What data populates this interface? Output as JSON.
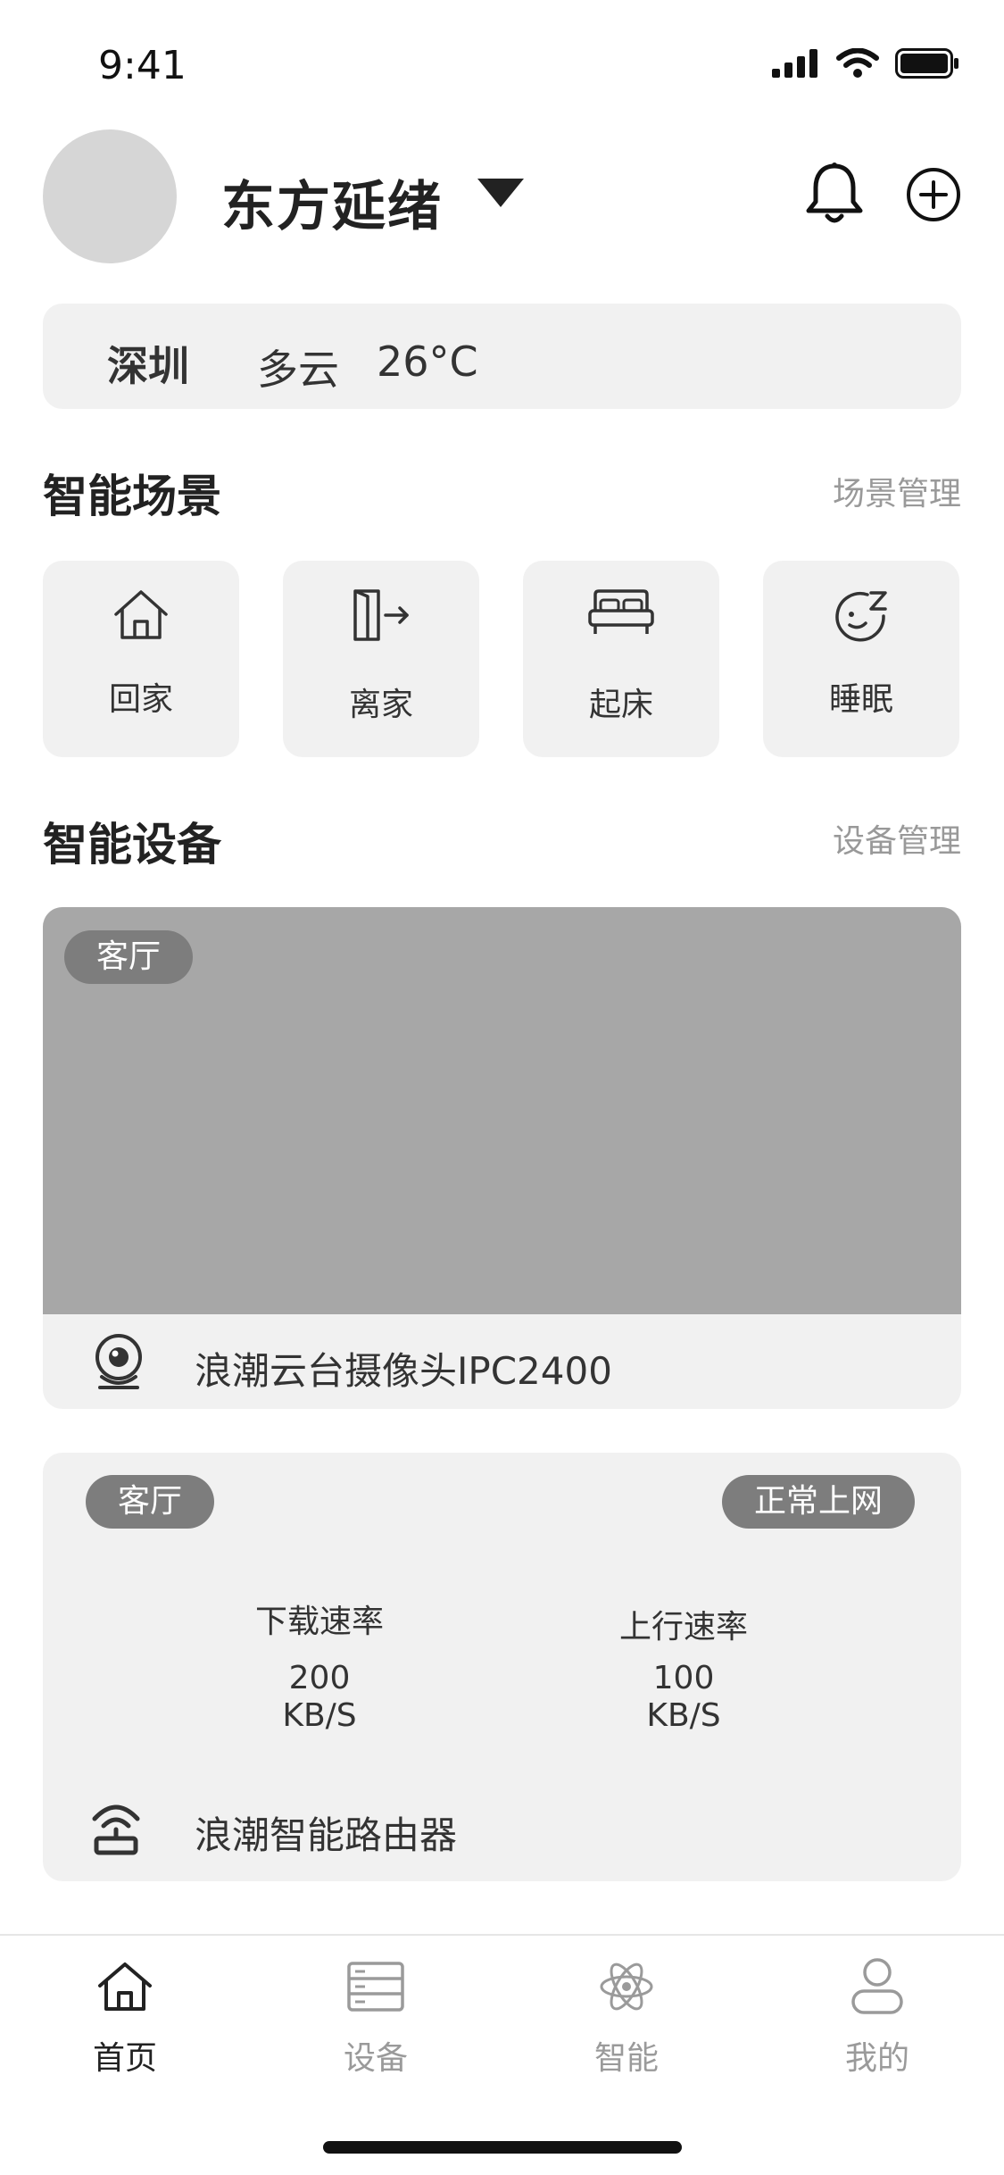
{
  "status_bar": {
    "time": "9:41"
  },
  "header": {
    "home_name": "东方延绪"
  },
  "weather": {
    "city": "深圳",
    "condition": "多云",
    "temperature": "26°C"
  },
  "scenes_section": {
    "title": "智能场景",
    "manage_link": "场景管理",
    "items": [
      {
        "label": "回家",
        "icon": "home-icon"
      },
      {
        "label": "离家",
        "icon": "leave-door-icon"
      },
      {
        "label": "起床",
        "icon": "bed-icon"
      },
      {
        "label": "睡眠",
        "icon": "sleep-face-icon"
      }
    ]
  },
  "devices_section": {
    "title": "智能设备",
    "manage_link": "设备管理",
    "camera": {
      "room": "客厅",
      "name": "浪潮云台摄像头IPC2400",
      "icon": "camera-icon"
    },
    "router": {
      "room": "客厅",
      "status": "正常上网",
      "download_label": "下载速率",
      "download_value": "200",
      "download_unit": "KB/S",
      "upload_label": "上行速率",
      "upload_value": "100",
      "upload_unit": "KB/S",
      "name": "浪潮智能路由器",
      "icon": "router-icon"
    }
  },
  "tabbar": {
    "items": [
      {
        "label": "首页",
        "icon": "home-icon",
        "active": true
      },
      {
        "label": "设备",
        "icon": "device-list-icon",
        "active": false
      },
      {
        "label": "智能",
        "icon": "atom-icon",
        "active": false
      },
      {
        "label": "我的",
        "icon": "user-icon",
        "active": false
      }
    ]
  },
  "colors": {
    "card_bg": "#f1f1f1",
    "preview_bg": "#a7a7a7",
    "tag_bg": "#7d7d7d",
    "active_tab": "#222222",
    "inactive_tab": "#9a9a9a"
  }
}
